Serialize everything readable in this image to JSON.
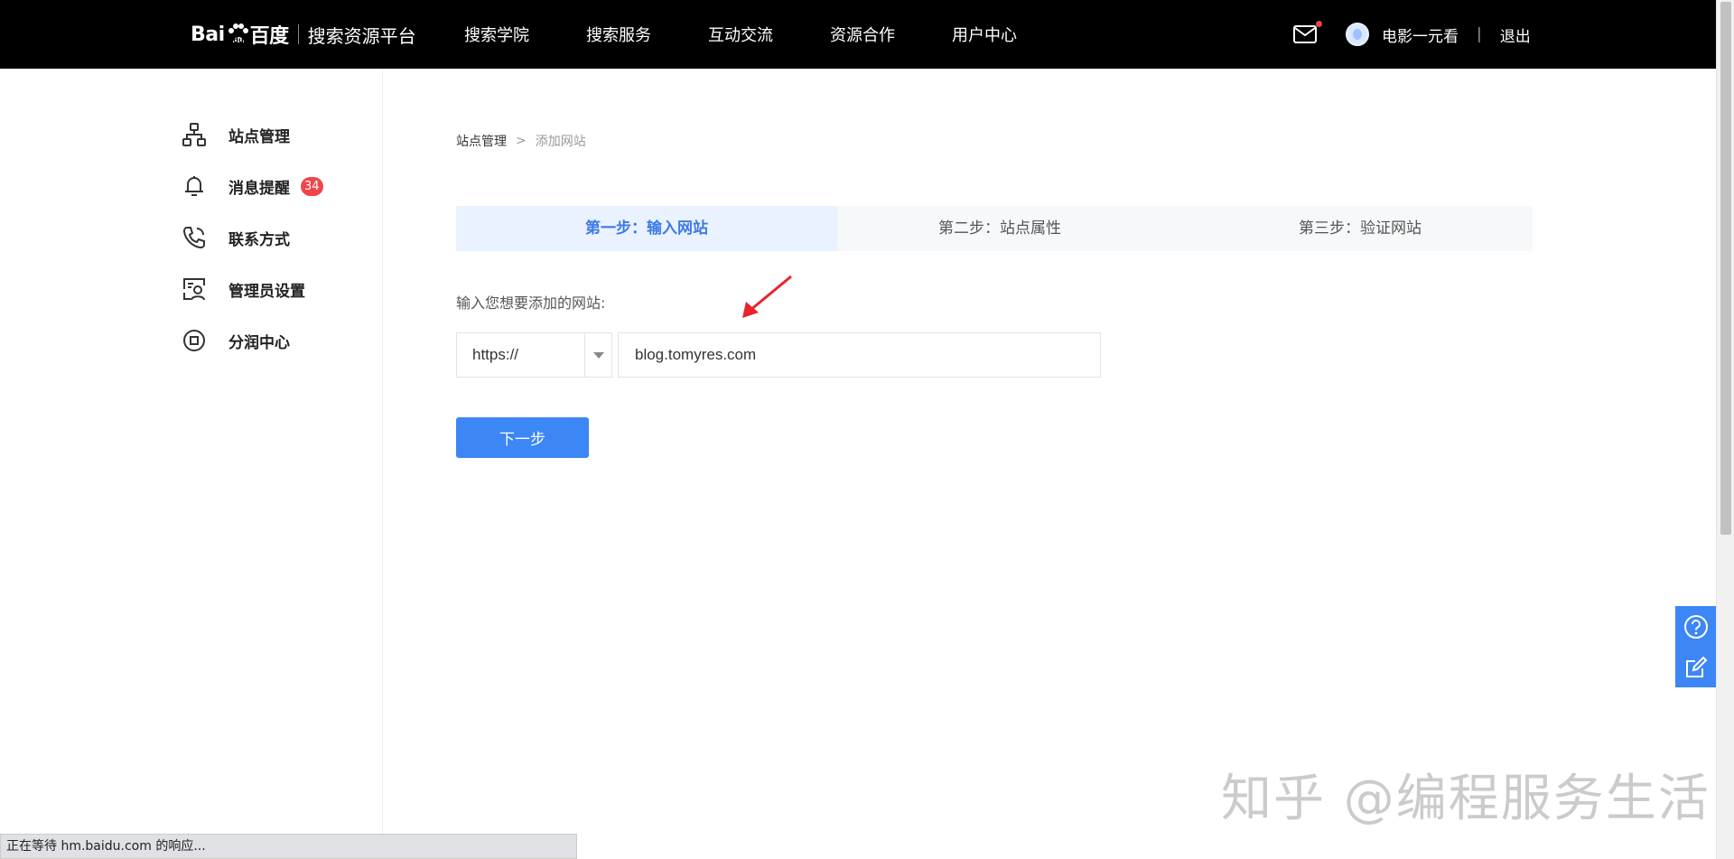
{
  "header": {
    "logo_left": "Bai",
    "logo_right": "百度",
    "platform": "搜索资源平台",
    "nav": [
      {
        "label": "搜索学院"
      },
      {
        "label": "搜索服务"
      },
      {
        "label": "互动交流"
      },
      {
        "label": "资源合作"
      },
      {
        "label": "用户中心"
      }
    ],
    "username": "电影一元看",
    "separator": "|",
    "logout": "退出"
  },
  "sidebar": {
    "items": [
      {
        "label": "站点管理",
        "icon": "sitemap-icon"
      },
      {
        "label": "消息提醒",
        "icon": "bell-icon",
        "badge": "34"
      },
      {
        "label": "联系方式",
        "icon": "phone-icon"
      },
      {
        "label": "管理员设置",
        "icon": "admin-icon"
      },
      {
        "label": "分润中心",
        "icon": "coin-icon"
      }
    ]
  },
  "breadcrumb": {
    "root": "站点管理",
    "sep": ">",
    "current": "添加网站"
  },
  "steps": [
    {
      "label": "第一步：输入网站",
      "active": true
    },
    {
      "label": "第二步：站点属性",
      "active": false
    },
    {
      "label": "第三步：验证网站",
      "active": false
    }
  ],
  "form": {
    "label": "输入您想要添加的网站:",
    "protocol": "https://",
    "url_value": "blog.tomyres.com",
    "next_label": "下一步"
  },
  "watermark": "知乎 @编程服务生活",
  "status_bar": "正在等待 hm.baidu.com 的响应...",
  "colors": {
    "header_bg": "#000000",
    "accent": "#3c86f5",
    "active_step_text": "#3c7ae6",
    "badge": "#f0464b"
  }
}
